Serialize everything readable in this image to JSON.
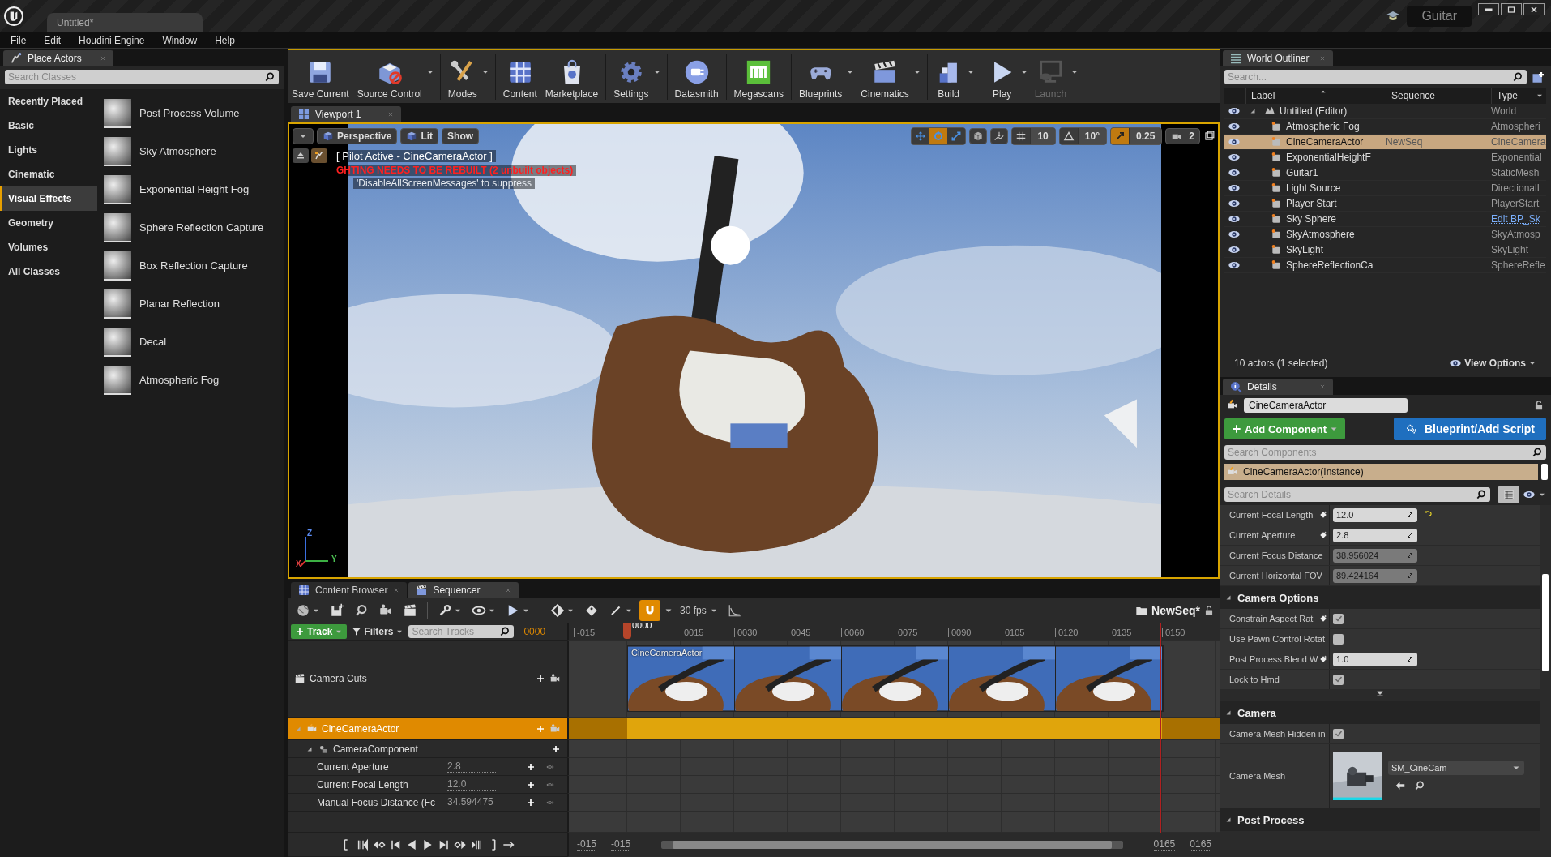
{
  "window": {
    "tab": "Untitled*",
    "project": "Guitar"
  },
  "menu": [
    "File",
    "Edit",
    "Houdini Engine",
    "Window",
    "Help"
  ],
  "place_actors": {
    "tab": "Place Actors",
    "search": {
      "placeholder": "Search Classes"
    },
    "categories": [
      {
        "label": "Recently Placed",
        "selected": false
      },
      {
        "label": "Basic",
        "selected": false
      },
      {
        "label": "Lights",
        "selected": false
      },
      {
        "label": "Cinematic",
        "selected": false
      },
      {
        "label": "Visual Effects",
        "selected": true
      },
      {
        "label": "Geometry",
        "selected": false
      },
      {
        "label": "Volumes",
        "selected": false
      },
      {
        "label": "All Classes",
        "selected": false
      }
    ],
    "items": [
      "Post Process Volume",
      "Sky Atmosphere",
      "Exponential Height Fog",
      "Sphere Reflection Capture",
      "Box Reflection Capture",
      "Planar Reflection",
      "Decal",
      "Atmospheric Fog"
    ]
  },
  "toolbar": [
    {
      "label": "Save Current",
      "dropdown": false,
      "disabled": false
    },
    {
      "label": "Source Control",
      "dropdown": true,
      "disabled": false
    },
    {
      "label": "Modes",
      "dropdown": true,
      "disabled": false
    },
    {
      "label": "Content",
      "dropdown": false,
      "disabled": false
    },
    {
      "label": "Marketplace",
      "dropdown": false,
      "disabled": false
    },
    {
      "label": "Settings",
      "dropdown": true,
      "disabled": false
    },
    {
      "label": "Datasmith",
      "dropdown": false,
      "disabled": false
    },
    {
      "label": "Megascans",
      "dropdown": false,
      "disabled": false
    },
    {
      "label": "Blueprints",
      "dropdown": true,
      "disabled": false
    },
    {
      "label": "Cinematics",
      "dropdown": true,
      "disabled": false
    },
    {
      "label": "Build",
      "dropdown": true,
      "disabled": false
    },
    {
      "label": "Play",
      "dropdown": true,
      "disabled": false
    },
    {
      "label": "Launch",
      "dropdown": true,
      "disabled": true
    }
  ],
  "viewport": {
    "tab": "Viewport 1",
    "view_buttons": [
      "Perspective",
      "Lit",
      "Show"
    ],
    "transform_modes": [
      {
        "selected": false
      },
      {
        "selected": true
      },
      {
        "selected": false
      }
    ],
    "snaps": [
      {
        "value": "10",
        "on": false
      },
      {
        "value": "10°",
        "on": false
      },
      {
        "value": "0.25",
        "on": true
      }
    ],
    "camera_speed": "2",
    "pilot": "[ Pilot Active - CineCameraActor ]",
    "warning": "GHTING NEEDS TO BE REBUILT (2 unbuilt objects)",
    "hint": "'DisableAllScreenMessages' to suppress",
    "axes": [
      "Z",
      "Y",
      "X"
    ]
  },
  "sequencer": {
    "tabs": [
      {
        "label": "Content Browser",
        "selected": false
      },
      {
        "label": "Sequencer",
        "selected": true
      }
    ],
    "frame_rate": "30 fps",
    "sequence": "NewSeq*",
    "add_track": "Track",
    "filters": "Filters",
    "search": {
      "placeholder": "Search Tracks"
    },
    "current_frame": "0000",
    "ruler": [
      "-015",
      "0000",
      "0015",
      "0030",
      "0045",
      "0060",
      "0075",
      "0090",
      "0105",
      "0120",
      "0135",
      "0150"
    ],
    "tracks": [
      {
        "kind": "camera_cuts",
        "label": "Camera Cuts",
        "selected": false,
        "section": "CineCameraActor"
      },
      {
        "kind": "actor",
        "label": "CineCameraActor",
        "selected": true,
        "expanded": true,
        "children": [
          {
            "kind": "component",
            "label": "CameraComponent",
            "selected": false,
            "expanded": true,
            "children": [
              {
                "kind": "property",
                "label": "Current Aperture",
                "value": "2.8",
                "selected": false
              },
              {
                "kind": "property",
                "label": "Current Focal Length",
                "value": "12.0",
                "selected": false
              },
              {
                "kind": "property",
                "label": "Manual Focus Distance (Fc",
                "value": "34.594475",
                "selected": false
              }
            ]
          }
        ]
      }
    ],
    "view_range": [
      "-015",
      "-015",
      "0165",
      "0165"
    ]
  },
  "outliner": {
    "tab": "World Outliner",
    "search": {
      "placeholder": "Search..."
    },
    "columns": [
      "Label",
      "Sequence",
      "Type"
    ],
    "rows": [
      {
        "label": "Untitled (Editor)",
        "type": "World",
        "link": false,
        "selected": false,
        "expanded": true,
        "children": [
          {
            "label": "Atmospheric Fog",
            "type": "Atmospheri",
            "link": false,
            "selected": false
          },
          {
            "label": "CineCameraActor",
            "sequence": "NewSeq",
            "type": "CineCamera",
            "link": false,
            "selected": true
          },
          {
            "label": "ExponentialHeightF",
            "type": "Exponential",
            "link": false,
            "selected": false
          },
          {
            "label": "Guitar1",
            "type": "StaticMesh",
            "link": false,
            "selected": false
          },
          {
            "label": "Light Source",
            "type": "DirectionalL",
            "link": false,
            "selected": false
          },
          {
            "label": "Player Start",
            "type": "PlayerStart",
            "link": false,
            "selected": false
          },
          {
            "label": "Sky Sphere",
            "type": "Edit BP_Sk",
            "link": true,
            "selected": false
          },
          {
            "label": "SkyAtmosphere",
            "type": "SkyAtmosp",
            "link": false,
            "selected": false
          },
          {
            "label": "SkyLight",
            "type": "SkyLight",
            "link": false,
            "selected": false
          },
          {
            "label": "SphereReflectionCa",
            "type": "SphereRefle",
            "link": false,
            "selected": false
          }
        ]
      }
    ],
    "footer": "10 actors (1 selected)",
    "view_options": "View Options"
  },
  "details": {
    "tab": "Details",
    "name": "CineCameraActor",
    "add_component": "Add Component",
    "blueprint": "Blueprint/Add Script",
    "component_search": {
      "placeholder": "Search Components"
    },
    "components": [
      {
        "label": "CineCameraActor(Instance)",
        "selected": true
      }
    ],
    "detail_search": {
      "placeholder": "Search Details"
    },
    "sections": [
      {
        "properties": [
          {
            "kind": "number",
            "label": "Current Focal Length",
            "value": "12.0",
            "keyable": true,
            "disabled": false,
            "reset": true
          },
          {
            "kind": "number",
            "label": "Current Aperture",
            "value": "2.8",
            "keyable": true,
            "disabled": false,
            "reset": false
          },
          {
            "kind": "number",
            "label": "Current Focus Distance",
            "value": "38.956024",
            "keyable": false,
            "disabled": true,
            "reset": false
          },
          {
            "kind": "number",
            "label": "Current Horizontal FOV",
            "value": "89.424164",
            "keyable": false,
            "disabled": true,
            "reset": false
          }
        ]
      },
      {
        "title": "Camera Options",
        "expanded": true,
        "advanced": true,
        "properties": [
          {
            "kind": "checkbox",
            "label": "Constrain Aspect Rat",
            "checked": true,
            "keyable": true
          },
          {
            "kind": "checkbox",
            "label": "Use Pawn Control Rotat",
            "checked": false,
            "keyable": false
          },
          {
            "kind": "number",
            "label": "Post Process Blend W",
            "value": "1.0",
            "keyable": true,
            "disabled": false,
            "reset": false
          },
          {
            "kind": "checkbox",
            "label": "Lock to Hmd",
            "checked": true,
            "keyable": false
          }
        ]
      },
      {
        "title": "Camera",
        "expanded": true,
        "advanced": false,
        "properties": [
          {
            "kind": "checkbox",
            "label": "Camera Mesh Hidden in",
            "checked": true,
            "keyable": false
          },
          {
            "kind": "asset",
            "label": "Camera Mesh",
            "value": "SM_CineCam",
            "keyable": false
          }
        ]
      },
      {
        "title": "Post Process",
        "expanded": true,
        "advanced": false
      }
    ]
  }
}
